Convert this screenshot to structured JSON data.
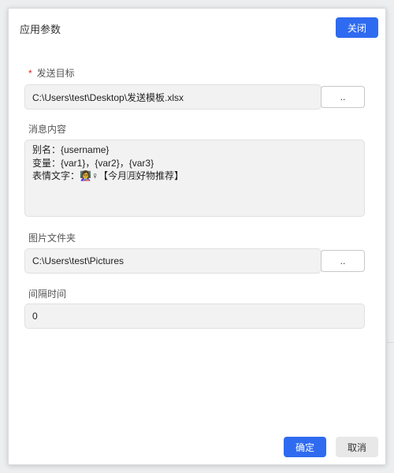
{
  "dialog": {
    "title": "应用参数",
    "close_label": "关闭",
    "confirm_label": "确定",
    "cancel_label": "取消"
  },
  "fields": {
    "target": {
      "required_mark": "*",
      "label": "发送目标",
      "value": "C:\\Users\\test\\Desktop\\发送模板.xlsx",
      "browse_label": ".."
    },
    "message": {
      "label": "消息内容",
      "lines": [
        "别名：{username}",
        "变量：{var1}，{var2}，{var3}",
        "表情文字：👩‍🏫♀【今月🈷好物推荐】"
      ]
    },
    "images": {
      "label": "图片文件夹",
      "value": "C:\\Users\\test\\Pictures",
      "browse_label": ".."
    },
    "interval": {
      "label": "间隔时间",
      "value": "0"
    }
  },
  "colors": {
    "primary": "#2f6bf0",
    "required": "#e02020",
    "field_bg": "#f2f2f2"
  }
}
